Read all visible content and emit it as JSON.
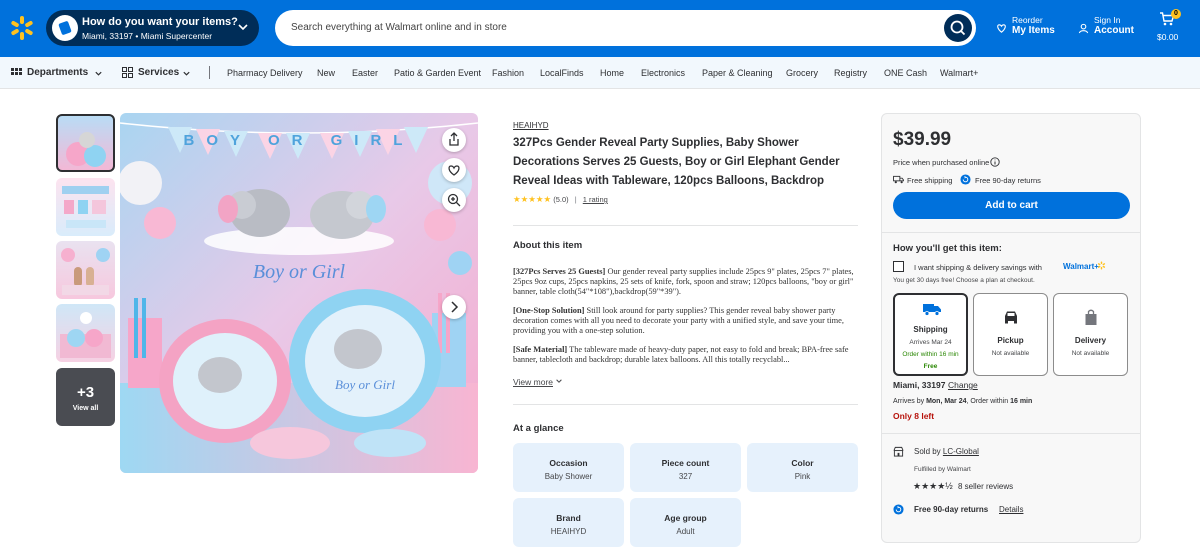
{
  "header": {
    "pickup_title": "How do you want your items?",
    "pickup_sub": "Miami, 33197 • Miami Supercenter",
    "search_placeholder": "Search everything at Walmart online and in store",
    "reorder_small": "Reorder",
    "reorder_big": "My Items",
    "signin_small": "Sign In",
    "signin_big": "Account",
    "cart_count": "0",
    "cart_total": "$0.00"
  },
  "nav": {
    "departments": "Departments",
    "services": "Services",
    "items": [
      "Pharmacy Delivery",
      "New",
      "Easter",
      "Patio & Garden Event",
      "Fashion",
      "LocalFinds",
      "Home",
      "Electronics",
      "Paper & Cleaning",
      "Grocery",
      "Registry",
      "ONE Cash",
      "Walmart+"
    ]
  },
  "gallery": {
    "more_count": "+3",
    "view_all": "View all",
    "banner_text": "BOY OR GIRL",
    "image_caption": "Boy or Girl",
    "plate_caption": "Boy or Girl"
  },
  "product": {
    "brand": "HEAIHYD",
    "title": "327Pcs Gender Reveal Party Supplies, Baby Shower Decorations Serves 25 Guests, Boy or Girl Elephant Gender Reveal Ideas with Tableware, 120pcs Balloons, Backdrop",
    "stars": "★★★★★",
    "rating_value": "(5.0)",
    "rating_count": "1 rating",
    "about_title": "About this item",
    "about": [
      {
        "lead": "[327Pcs Serves 25 Guests]",
        "text": " Our gender reveal party supplies include 25pcs 9\" plates, 25pcs 7\" plates, 25pcs 9oz cups, 25pcs napkins, 25 sets of knife, fork, spoon and straw; 120pcs balloons, \"boy or girl\" banner, table cloth(54\"*108\"),backdrop(59\"*39\")."
      },
      {
        "lead": "[One-Stop Solution]",
        "text": " Still look around for party supplies? This gender reveal baby shower party decoration comes with all you need to decorate your party with a unified style, and save your time, providing you with a one-step solution."
      },
      {
        "lead": "[Safe Material]",
        "text": " The tableware made of heavy-duty paper, not easy to fold and break; BPA-free safe banner, tablecloth and backdrop; durable latex balloons. All this totally recyclabl..."
      }
    ],
    "view_more": "View more",
    "glance_title": "At a glance",
    "glance": [
      {
        "k": "Occasion",
        "v": "Baby Shower"
      },
      {
        "k": "Piece count",
        "v": "327"
      },
      {
        "k": "Color",
        "v": "Pink"
      },
      {
        "k": "Brand",
        "v": "HEAIHYD"
      },
      {
        "k": "Age group",
        "v": "Adult"
      }
    ]
  },
  "buybox": {
    "price": "$39.99",
    "price_note": "Price when purchased online",
    "free_shipping": "Free shipping",
    "free_returns": "Free 90-day returns",
    "add_to_cart": "Add to cart",
    "how_get": "How you'll get this item:",
    "wplus_text": "I want shipping & delivery savings with",
    "wplus_brand": "Walmart+",
    "wplus_note": "You get 30 days free! Choose a plan at checkout.",
    "options": [
      {
        "name": "Shipping",
        "l1": "Arrives Mar 24",
        "l2": "Order within 16 min",
        "l3": "Free"
      },
      {
        "name": "Pickup",
        "l1": "Not available"
      },
      {
        "name": "Delivery",
        "l1": "Not available"
      }
    ],
    "location": "Miami, 33197",
    "change": "Change",
    "arrives_pre": "Arrives by ",
    "arrives_date": "Mon, Mar 24",
    "arrives_mid": ",  Order within ",
    "arrives_time": "16 min",
    "stock": "Only 8 left",
    "sold_by_pre": "Sold by ",
    "seller": "LC-Global",
    "fulfilled": "Fulfilled by Walmart",
    "seller_stars": "★★★★½",
    "seller_reviews": "8 seller reviews",
    "returns": "Free 90-day returns",
    "details": "Details"
  },
  "colors": {
    "brand_blue": "#0071dc",
    "dark_blue": "#002d58",
    "spark": "#ffc220",
    "stock_red": "#b7130c",
    "green": "#2a8703"
  }
}
